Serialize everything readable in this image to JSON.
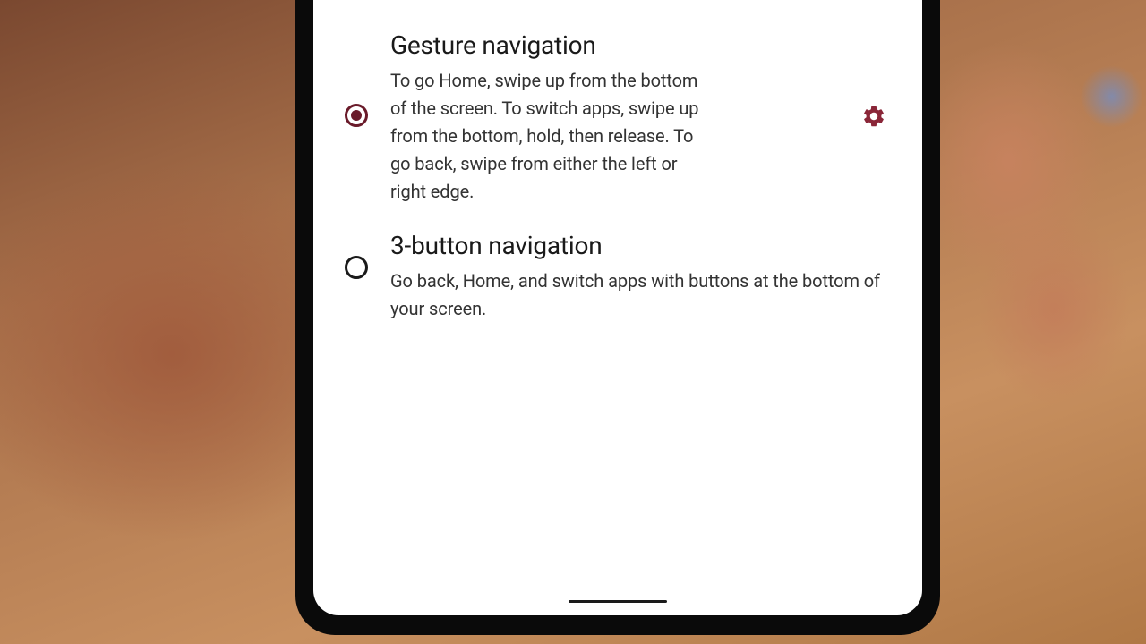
{
  "navigation_options": [
    {
      "id": "gesture",
      "title": "Gesture navigation",
      "description": "To go Home, swipe up from the bottom of the screen. To switch apps, swipe up from the bottom, hold, then release. To go back, swipe from either the left or right edge.",
      "selected": true,
      "has_settings": true
    },
    {
      "id": "three-button",
      "title": "3-button navigation",
      "description": "Go back, Home, and switch apps with buttons at the bottom of your screen.",
      "selected": false,
      "has_settings": false
    }
  ],
  "colors": {
    "accent": "#8a2638",
    "radio_selected": "#6a1b2a",
    "text_primary": "#1a1a1a"
  }
}
